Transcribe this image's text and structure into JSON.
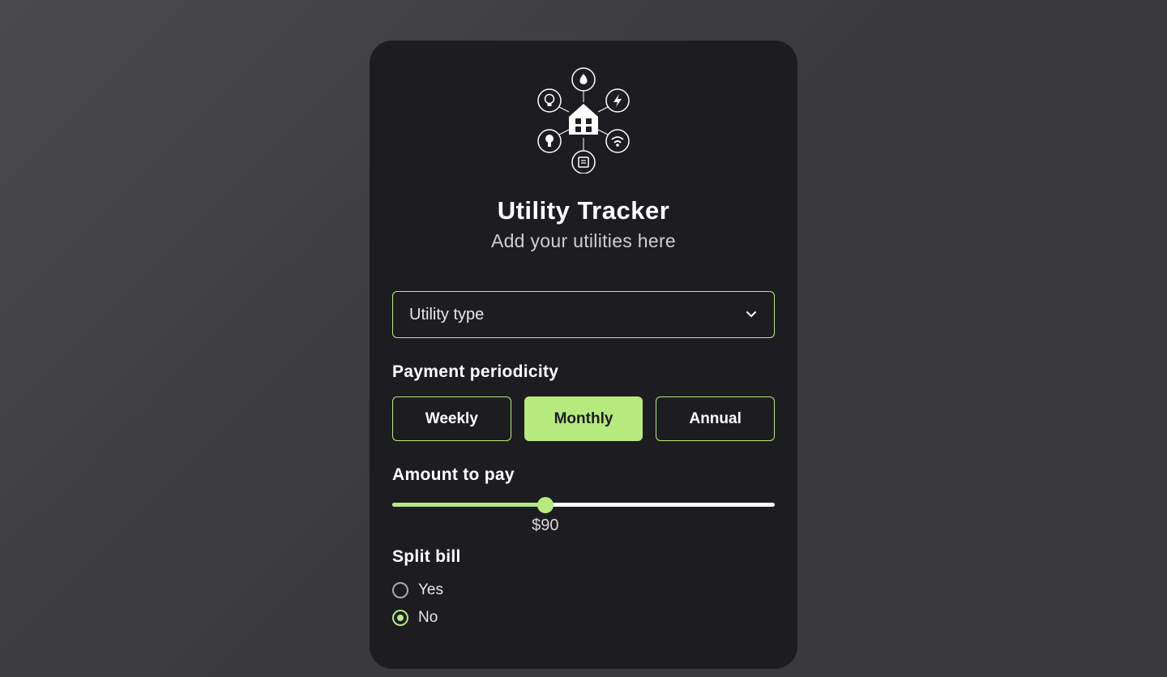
{
  "header": {
    "title": "Utility Tracker",
    "subtitle": "Add your utilities here"
  },
  "select": {
    "placeholder": "Utility type"
  },
  "periodicity": {
    "label": "Payment periodicity",
    "options": [
      "Weekly",
      "Monthly",
      "Annual"
    ],
    "selected": "Monthly"
  },
  "amount": {
    "label": "Amount to pay",
    "value": 90,
    "display": "$90",
    "percent": 40
  },
  "split": {
    "label": "Split bill",
    "options": [
      "Yes",
      "No"
    ],
    "selected": "No"
  },
  "colors": {
    "accent": "#b6ea7f",
    "cardBg": "#1d1c21"
  }
}
